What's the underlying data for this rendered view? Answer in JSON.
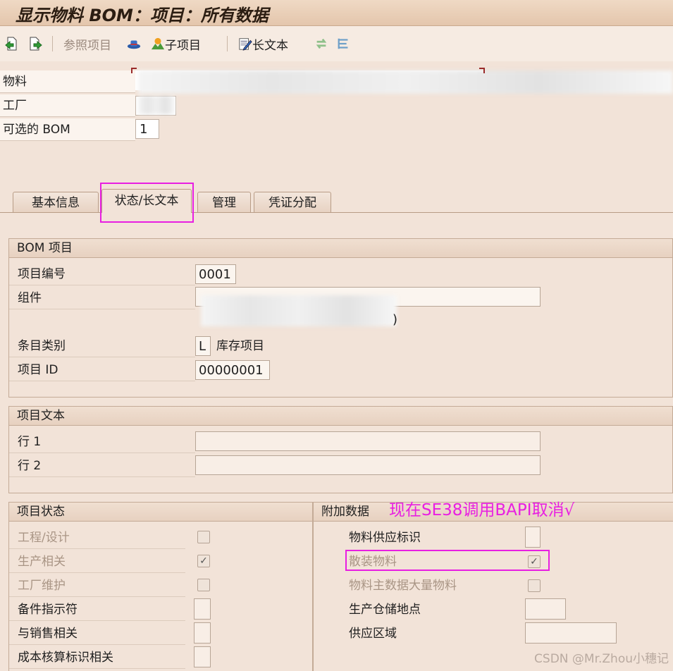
{
  "window": {
    "title": "显示物料 BOM：项目：所有数据"
  },
  "toolbar": {
    "ref_item": "参照项目",
    "sub_item": "子项目",
    "long_text": "长文本"
  },
  "header": {
    "material_label": "物料",
    "plant_label": "工厂",
    "alt_bom_label": "可选的 BOM",
    "alt_bom_value": "1"
  },
  "tabs": [
    {
      "label": "基本信息"
    },
    {
      "label": "状态/长文本"
    },
    {
      "label": "管理"
    },
    {
      "label": "凭证分配"
    }
  ],
  "bom_item": {
    "title": "BOM 项目",
    "item_no_label": "项目编号",
    "item_no_value": "0001",
    "component_label": "组件",
    "component_desc_tail": ")",
    "item_category_label": "条目类别",
    "item_category_value": "L",
    "item_category_text": "库存项目",
    "item_id_label": "项目 ID",
    "item_id_value": "00000001"
  },
  "item_text": {
    "title": "项目文本",
    "line1_label": "行 1",
    "line2_label": "行 2"
  },
  "item_status": {
    "title": "项目状态",
    "engineering": "工程/设计",
    "production": "生产相关",
    "plant_maint": "工厂维护",
    "spare_part": "备件指示符",
    "sales": "与销售相关",
    "costing": "成本核算标识相关",
    "check_mark": "✓"
  },
  "additional": {
    "title": "附加数据",
    "supply_ind": "物料供应标识",
    "bulk_material": "散装物料",
    "bulk_master": "物料主数据大量物料",
    "prod_storage": "生产仓储地点",
    "supply_area": "供应区域"
  },
  "annotation": "现在SE38调用BAPI取消√",
  "watermark": "CSDN @Mr.Zhou小穗记"
}
